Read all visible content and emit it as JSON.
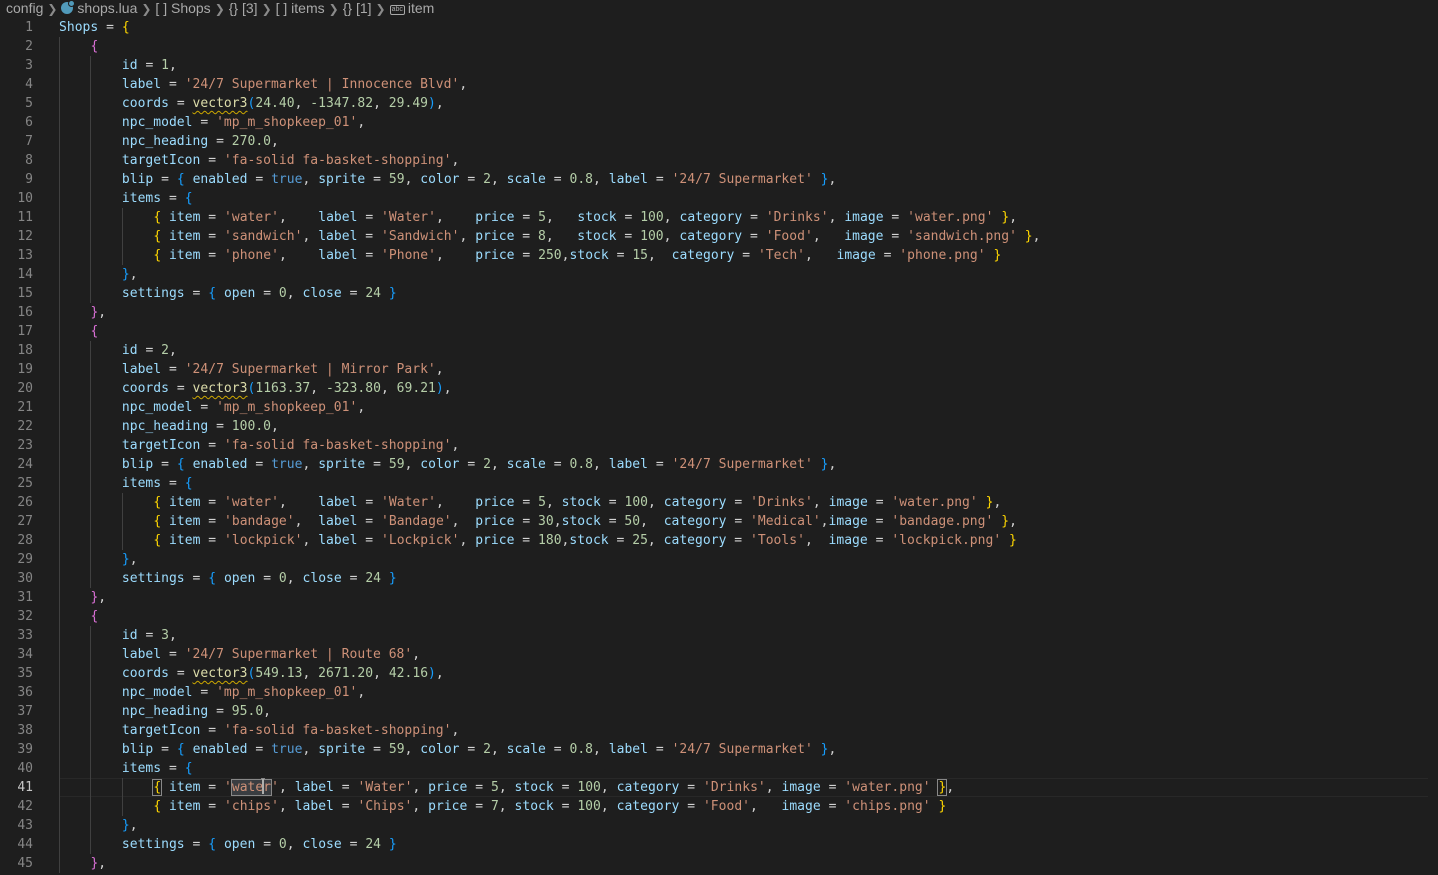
{
  "breadcrumb": [
    "config",
    "shops.lua",
    "[ ] Shops",
    "{} [3]",
    "[ ] items",
    "{} [1]",
    "item"
  ],
  "lines": [
    "Shops = {",
    "    {",
    "        id = 1,",
    "        label = '24/7 Supermarket | Innocence Blvd',",
    "        coords = vector3(24.40, -1347.82, 29.49),",
    "        npc_model = 'mp_m_shopkeep_01',",
    "        npc_heading = 270.0,",
    "        targetIcon = 'fa-solid fa-basket-shopping',",
    "        blip = { enabled = true, sprite = 59, color = 2, scale = 0.8, label = '24/7 Supermarket' },",
    "        items = {",
    "            { item = 'water',    label = 'Water',    price = 5,   stock = 100, category = 'Drinks', image = 'water.png' },",
    "            { item = 'sandwich', label = 'Sandwich', price = 8,   stock = 100, category = 'Food',   image = 'sandwich.png' },",
    "            { item = 'phone',    label = 'Phone',    price = 250,stock = 15,  category = 'Tech',   image = 'phone.png' }",
    "        },",
    "        settings = { open = 0, close = 24 }",
    "    },",
    "    {",
    "        id = 2,",
    "        label = '24/7 Supermarket | Mirror Park',",
    "        coords = vector3(1163.37, -323.80, 69.21),",
    "        npc_model = 'mp_m_shopkeep_01',",
    "        npc_heading = 100.0,",
    "        targetIcon = 'fa-solid fa-basket-shopping',",
    "        blip = { enabled = true, sprite = 59, color = 2, scale = 0.8, label = '24/7 Supermarket' },",
    "        items = {",
    "            { item = 'water',    label = 'Water',    price = 5, stock = 100, category = 'Drinks', image = 'water.png' },",
    "            { item = 'bandage',  label = 'Bandage',  price = 30,stock = 50,  category = 'Medical',image = 'bandage.png' },",
    "            { item = 'lockpick', label = 'Lockpick', price = 180,stock = 25, category = 'Tools',  image = 'lockpick.png' }",
    "        },",
    "        settings = { open = 0, close = 24 }",
    "    },",
    "    {",
    "        id = 3,",
    "        label = '24/7 Supermarket | Route 68',",
    "        coords = vector3(549.13, 2671.20, 42.16),",
    "        npc_model = 'mp_m_shopkeep_01',",
    "        npc_heading = 95.0,",
    "        targetIcon = 'fa-solid fa-basket-shopping',",
    "        blip = { enabled = true, sprite = 59, color = 2, scale = 0.8, label = '24/7 Supermarket' },",
    "        items = {",
    "            { item = 'water', label = 'Water', price = 5, stock = 100, category = 'Drinks', image = 'water.png' },",
    "            { item = 'chips', label = 'Chips', price = 7, stock = 100, category = 'Food',   image = 'chips.png' }",
    "        },",
    "        settings = { open = 0, close = 24 }",
    "    },"
  ],
  "current_line": 41,
  "highlighted_word": "water",
  "theme": {
    "background": "#1e1e1e",
    "variable": "#9cdcfe",
    "string": "#ce9178",
    "number": "#b5cea8",
    "keyword": "#569cd6",
    "function": "#dcdcaa",
    "bracket_level1": "#ffd700",
    "bracket_level2": "#da70d6",
    "bracket_level3": "#179fff"
  }
}
